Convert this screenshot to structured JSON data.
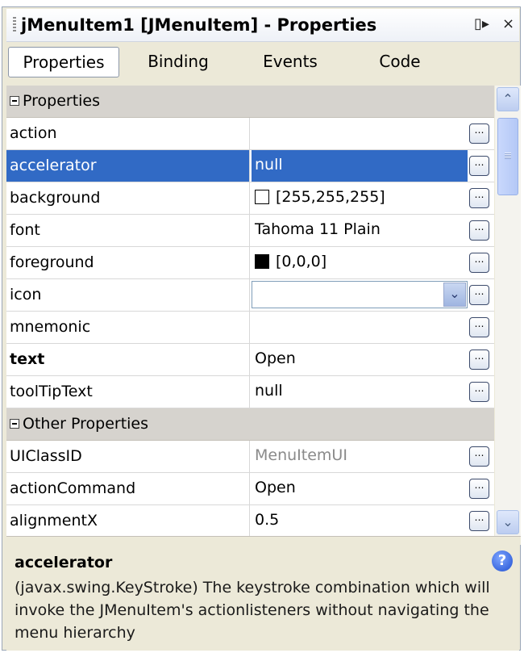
{
  "window": {
    "title": "jMenuItem1 [JMenuItem] - Properties",
    "pin_icon": "pin-icon",
    "close_icon": "close-icon",
    "pin_glyph": "▯▸",
    "close_glyph": "×"
  },
  "tabs": [
    {
      "label": "Properties",
      "active": true
    },
    {
      "label": "Binding",
      "active": false
    },
    {
      "label": "Events",
      "active": false
    },
    {
      "label": "Code",
      "active": false
    }
  ],
  "categories": {
    "properties": "Properties",
    "other": "Other Properties"
  },
  "properties": [
    {
      "name": "action",
      "value": ""
    },
    {
      "name": "accelerator",
      "value": "null",
      "selected": true
    },
    {
      "name": "background",
      "value": "[255,255,255]",
      "swatch": "#ffffff"
    },
    {
      "name": "font",
      "value": "Tahoma 11 Plain"
    },
    {
      "name": "foreground",
      "value": "[0,0,0]",
      "swatch": "#000000"
    },
    {
      "name": "icon",
      "value": ""
    },
    {
      "name": "mnemonic",
      "value": ""
    },
    {
      "name": "text",
      "value": "Open",
      "bold": true
    },
    {
      "name": "toolTipText",
      "value": "null"
    }
  ],
  "other_properties": [
    {
      "name": "UIClassID",
      "value": "MenuItemUI",
      "grey": true
    },
    {
      "name": "actionCommand",
      "value": "Open"
    },
    {
      "name": "alignmentX",
      "value": "0.5"
    }
  ],
  "ellipsis_glyph": "…",
  "description": {
    "title": "accelerator",
    "text": "(javax.swing.KeyStroke) The keystroke combination which will invoke the JMenuItem's actionlisteners without navigating the menu hierarchy"
  },
  "colors": {
    "selection": "#316ac5",
    "category_bg": "#d6d3ce"
  }
}
